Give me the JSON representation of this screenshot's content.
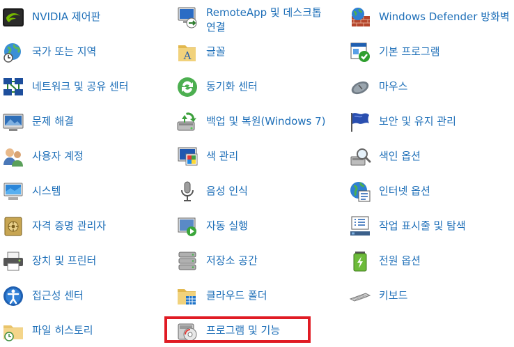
{
  "colors": {
    "link_text": "#1e6fb8",
    "highlight": "#e01b24",
    "background": "#ffffff"
  },
  "columns": [
    {
      "items": [
        {
          "label": "NVIDIA 제어판",
          "icon": "nvidia-icon"
        },
        {
          "label": "국가 또는 지역",
          "icon": "globe-clock-icon"
        },
        {
          "label": "네트워크 및 공유 센터",
          "icon": "network-icon"
        },
        {
          "label": "문제 해결",
          "icon": "troubleshoot-icon"
        },
        {
          "label": "사용자 계정",
          "icon": "users-icon"
        },
        {
          "label": "시스템",
          "icon": "system-icon"
        },
        {
          "label": "자격 증명 관리자",
          "icon": "vault-icon"
        },
        {
          "label": "장치 및 프린터",
          "icon": "printer-icon"
        },
        {
          "label": "접근성 센터",
          "icon": "accessibility-icon"
        },
        {
          "label": "파일 히스토리",
          "icon": "file-history-icon"
        }
      ]
    },
    {
      "items": [
        {
          "label": "RemoteApp 및 데스크톱 연결",
          "icon": "remote-desktop-icon"
        },
        {
          "label": "글꼴",
          "icon": "font-folder-icon"
        },
        {
          "label": "동기화 센터",
          "icon": "sync-icon"
        },
        {
          "label": "백업 및 복원(Windows 7)",
          "icon": "backup-icon"
        },
        {
          "label": "색 관리",
          "icon": "color-management-icon"
        },
        {
          "label": "음성 인식",
          "icon": "microphone-icon"
        },
        {
          "label": "자동 실행",
          "icon": "autoplay-icon"
        },
        {
          "label": "저장소 공간",
          "icon": "storage-icon"
        },
        {
          "label": "클라우드 폴더",
          "icon": "cloud-folder-icon"
        },
        {
          "label": "프로그램 및 기능",
          "icon": "programs-icon",
          "highlighted": true
        }
      ]
    },
    {
      "items": [
        {
          "label": "Windows Defender 방화벽",
          "icon": "firewall-icon"
        },
        {
          "label": "기본 프로그램",
          "icon": "default-programs-icon"
        },
        {
          "label": "마우스",
          "icon": "mouse-icon"
        },
        {
          "label": "보안 및 유지 관리",
          "icon": "flag-icon"
        },
        {
          "label": "색인 옵션",
          "icon": "indexing-icon"
        },
        {
          "label": "인터넷 옵션",
          "icon": "internet-options-icon"
        },
        {
          "label": "작업 표시줄 및 탐색",
          "icon": "taskbar-icon"
        },
        {
          "label": "전원 옵션",
          "icon": "power-icon"
        },
        {
          "label": "키보드",
          "icon": "keyboard-icon"
        }
      ]
    }
  ]
}
